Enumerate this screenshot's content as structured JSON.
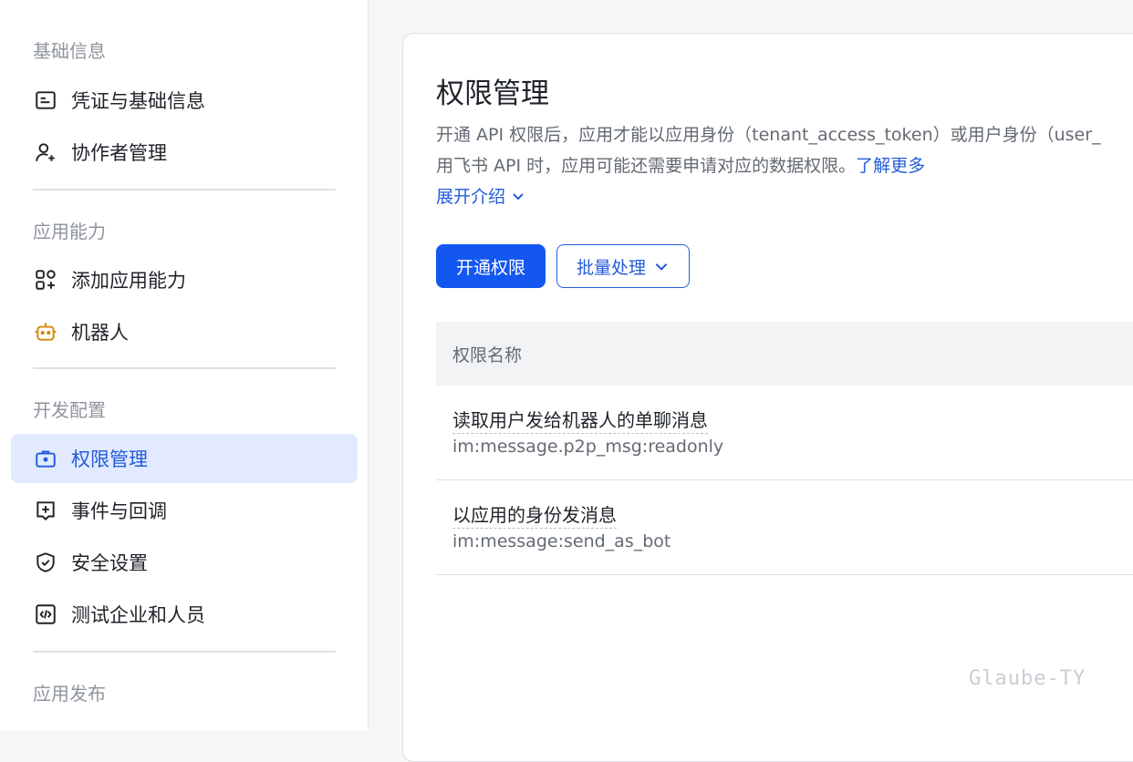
{
  "sidebar": {
    "sections": {
      "basic": "基础信息",
      "capability": "应用能力",
      "dev": "开发配置",
      "publish": "应用发布"
    },
    "items": [
      {
        "label": "凭证与基础信息",
        "icon": "id-card-icon"
      },
      {
        "label": "协作者管理",
        "icon": "user-add-icon"
      },
      {
        "label": "添加应用能力",
        "icon": "grid-add-icon"
      },
      {
        "label": "机器人",
        "icon": "robot-icon"
      },
      {
        "label": "权限管理",
        "icon": "briefcase-icon",
        "active": true
      },
      {
        "label": "事件与回调",
        "icon": "event-icon"
      },
      {
        "label": "安全设置",
        "icon": "shield-icon"
      },
      {
        "label": "测试企业和人员",
        "icon": "code-icon"
      }
    ]
  },
  "main": {
    "title": "权限管理",
    "desc_line1": "开通 API 权限后，应用才能以应用身份（tenant_access_token）或用户身份（user_",
    "desc_line2": "用飞书 API 时，应用可能还需要申请对应的数据权限。",
    "learn_more": "了解更多",
    "expand": "展开介绍",
    "btn_enable": "开通权限",
    "btn_batch": "批量处理",
    "table": {
      "header": "权限名称",
      "rows": [
        {
          "name": "读取用户发给机器人的单聊消息",
          "code": "im:message.p2p_msg:readonly"
        },
        {
          "name": "以应用的身份发消息",
          "code": "im:message:send_as_bot"
        }
      ]
    }
  },
  "watermark": "Glaube-TY",
  "colors": {
    "accent": "#1456f0",
    "link": "#245bdb",
    "active_bg": "#e1eaff",
    "robot": "#d48806"
  }
}
